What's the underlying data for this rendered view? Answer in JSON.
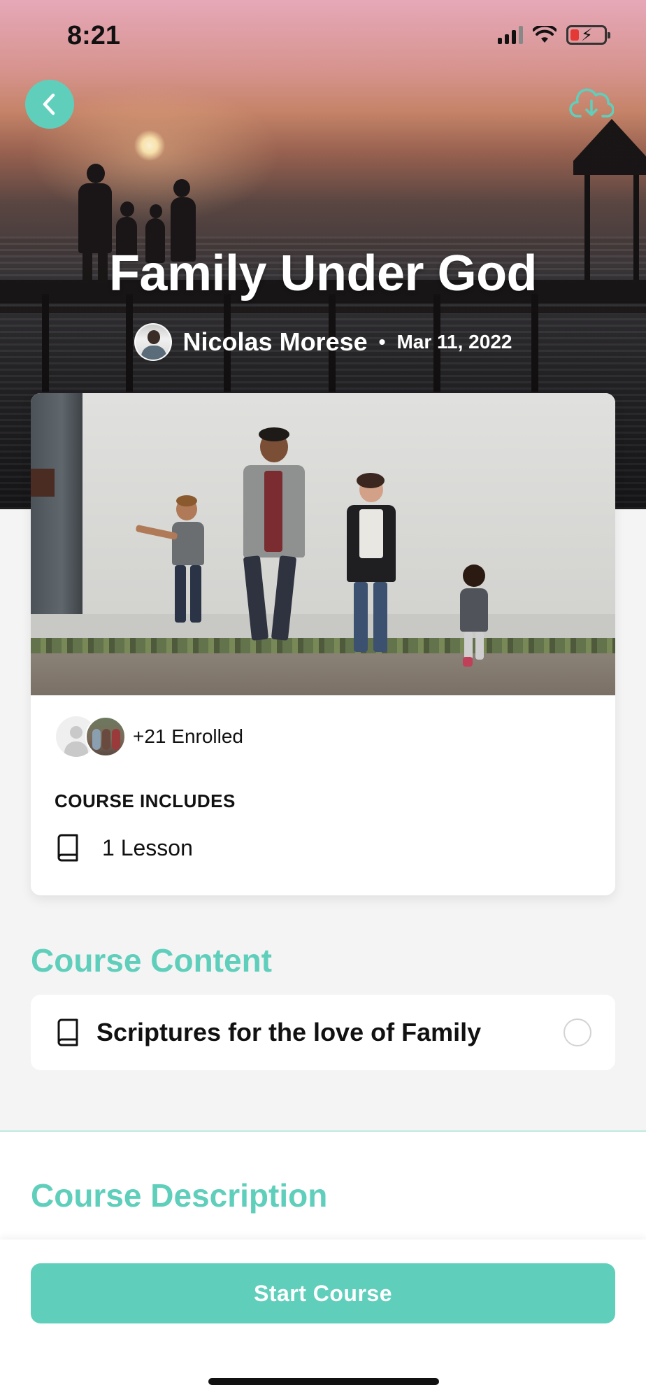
{
  "status_bar": {
    "time": "8:21",
    "signal_icon": "cellular-signal-icon",
    "wifi_icon": "wifi-icon",
    "battery_icon": "battery-low-charging-icon"
  },
  "header": {
    "back_icon": "chevron-left-icon",
    "download_icon": "cloud-download-icon",
    "title": "Family Under God",
    "author": "Nicolas Morese",
    "separator": "•",
    "date": "Mar 11, 2022"
  },
  "course_card": {
    "enrolled_text": "+21 Enrolled",
    "includes_label": "COURSE INCLUDES",
    "includes": [
      {
        "icon": "book-icon",
        "label": "1 Lesson"
      }
    ]
  },
  "course_content": {
    "title": "Course Content",
    "items": [
      {
        "icon": "book-icon",
        "label": "Scriptures for the love of Family",
        "completed": false
      }
    ]
  },
  "course_description": {
    "title": "Course Description"
  },
  "actions": {
    "start_label": "Start Course"
  },
  "colors": {
    "accent": "#5fcfbc",
    "background": "#f4f4f4",
    "card": "#ffffff"
  }
}
